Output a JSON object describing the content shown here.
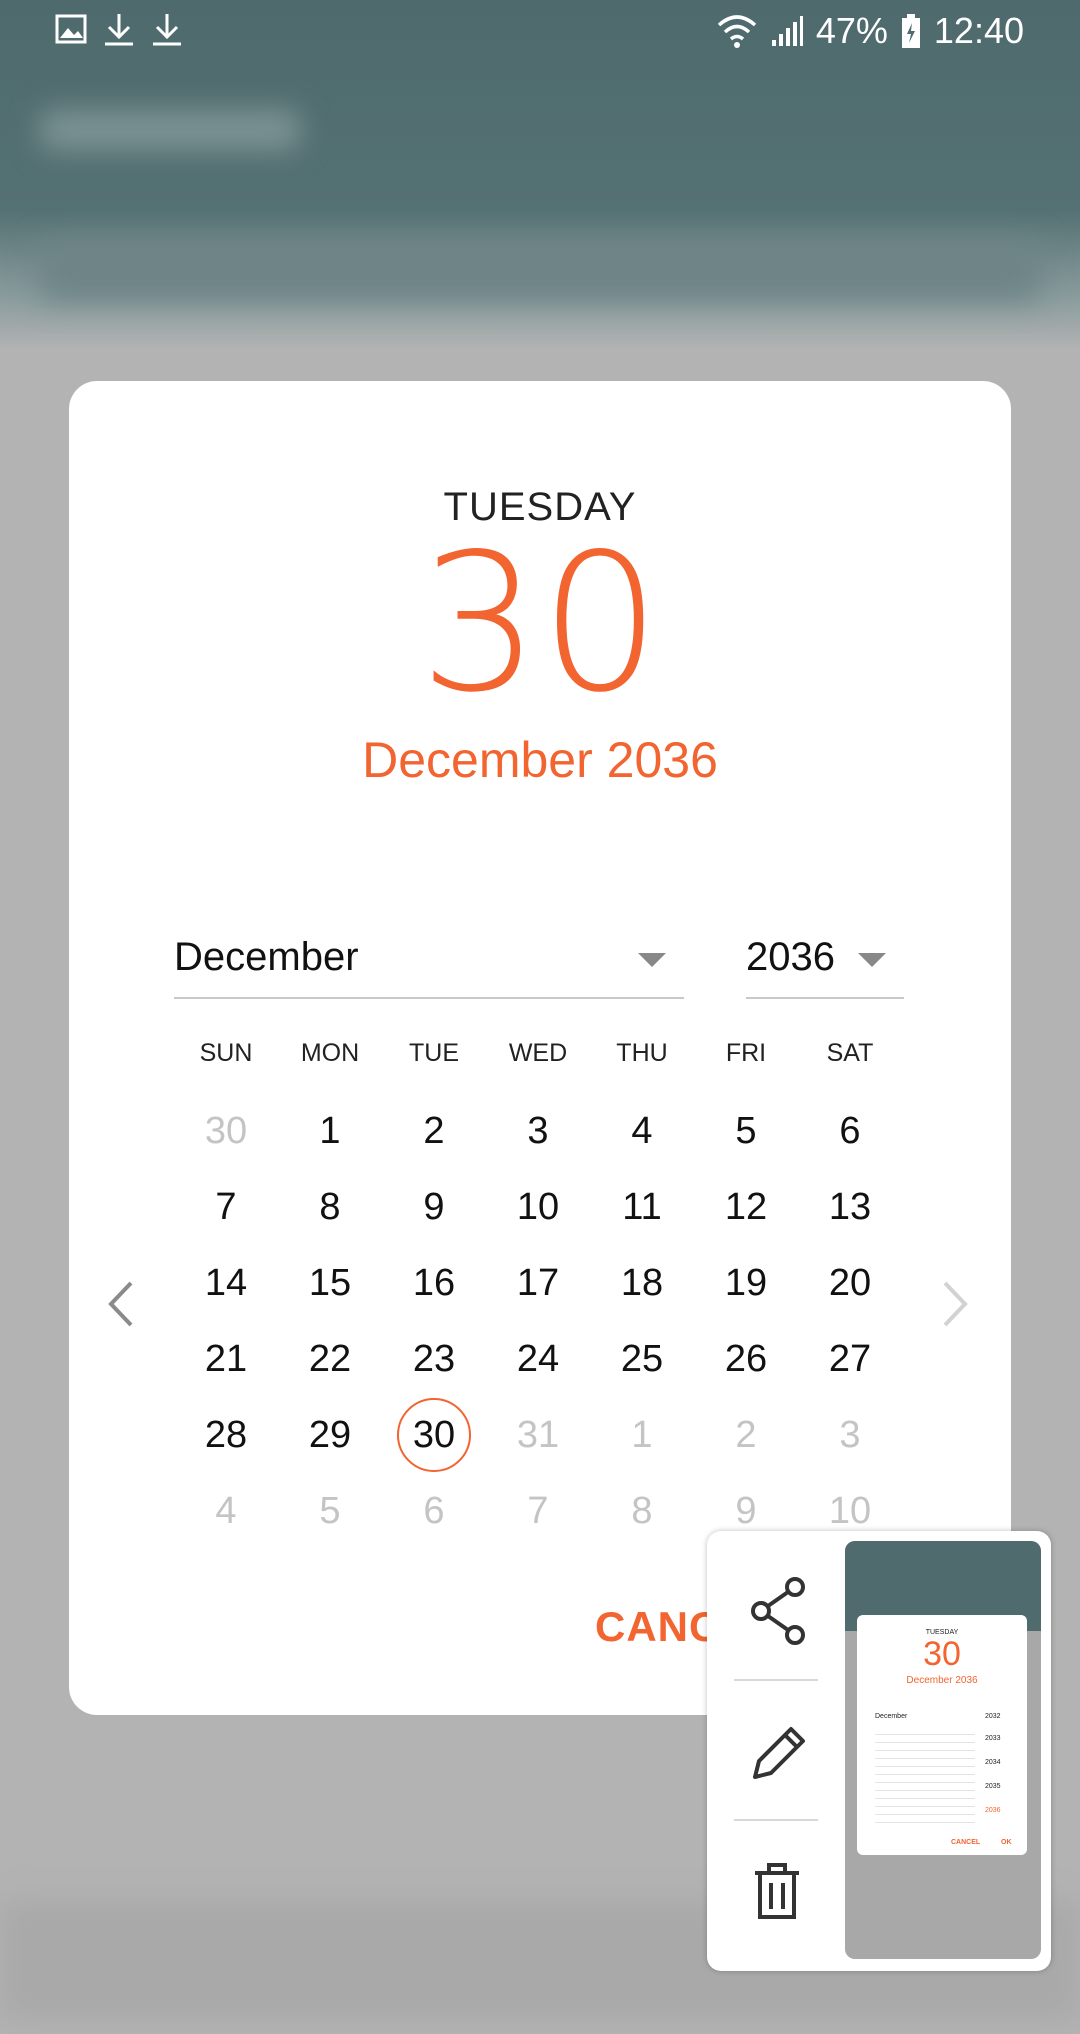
{
  "status_bar": {
    "battery_percent": "47%",
    "time": "12:40",
    "left_icons": [
      "image-icon",
      "download-icon",
      "download-icon"
    ],
    "right_icons": [
      "wifi-icon",
      "signal-icon",
      "battery-charging-icon"
    ]
  },
  "dialog": {
    "header": {
      "weekday": "TUESDAY",
      "day": "30",
      "month_year": "December 2036"
    },
    "month_select": {
      "value": "December"
    },
    "year_select": {
      "value": "2036"
    },
    "weekdays": [
      "SUN",
      "MON",
      "TUE",
      "WED",
      "THU",
      "FRI",
      "SAT"
    ],
    "weeks": [
      [
        "30",
        "1",
        "2",
        "3",
        "4",
        "5",
        "6"
      ],
      [
        "7",
        "8",
        "9",
        "10",
        "11",
        "12",
        "13"
      ],
      [
        "14",
        "15",
        "16",
        "17",
        "18",
        "19",
        "20"
      ],
      [
        "21",
        "22",
        "23",
        "24",
        "25",
        "26",
        "27"
      ],
      [
        "28",
        "29",
        "30",
        "31",
        "1",
        "2",
        "3"
      ],
      [
        "4",
        "5",
        "6",
        "7",
        "8",
        "9",
        "10"
      ]
    ],
    "selected_day": "30",
    "cancel_label": "CANC",
    "accent_color": "#f26430"
  },
  "screenshot_panel": {
    "tools": [
      "share-icon",
      "edit-icon",
      "delete-icon"
    ],
    "thumbnail": {
      "weekday": "TUESDAY",
      "day": "30",
      "month_year": "December 2036",
      "month": "December",
      "cancel": "CANCEL",
      "ok": "OK",
      "years": [
        "2032",
        "2033",
        "2034",
        "2035",
        "2036"
      ]
    }
  }
}
